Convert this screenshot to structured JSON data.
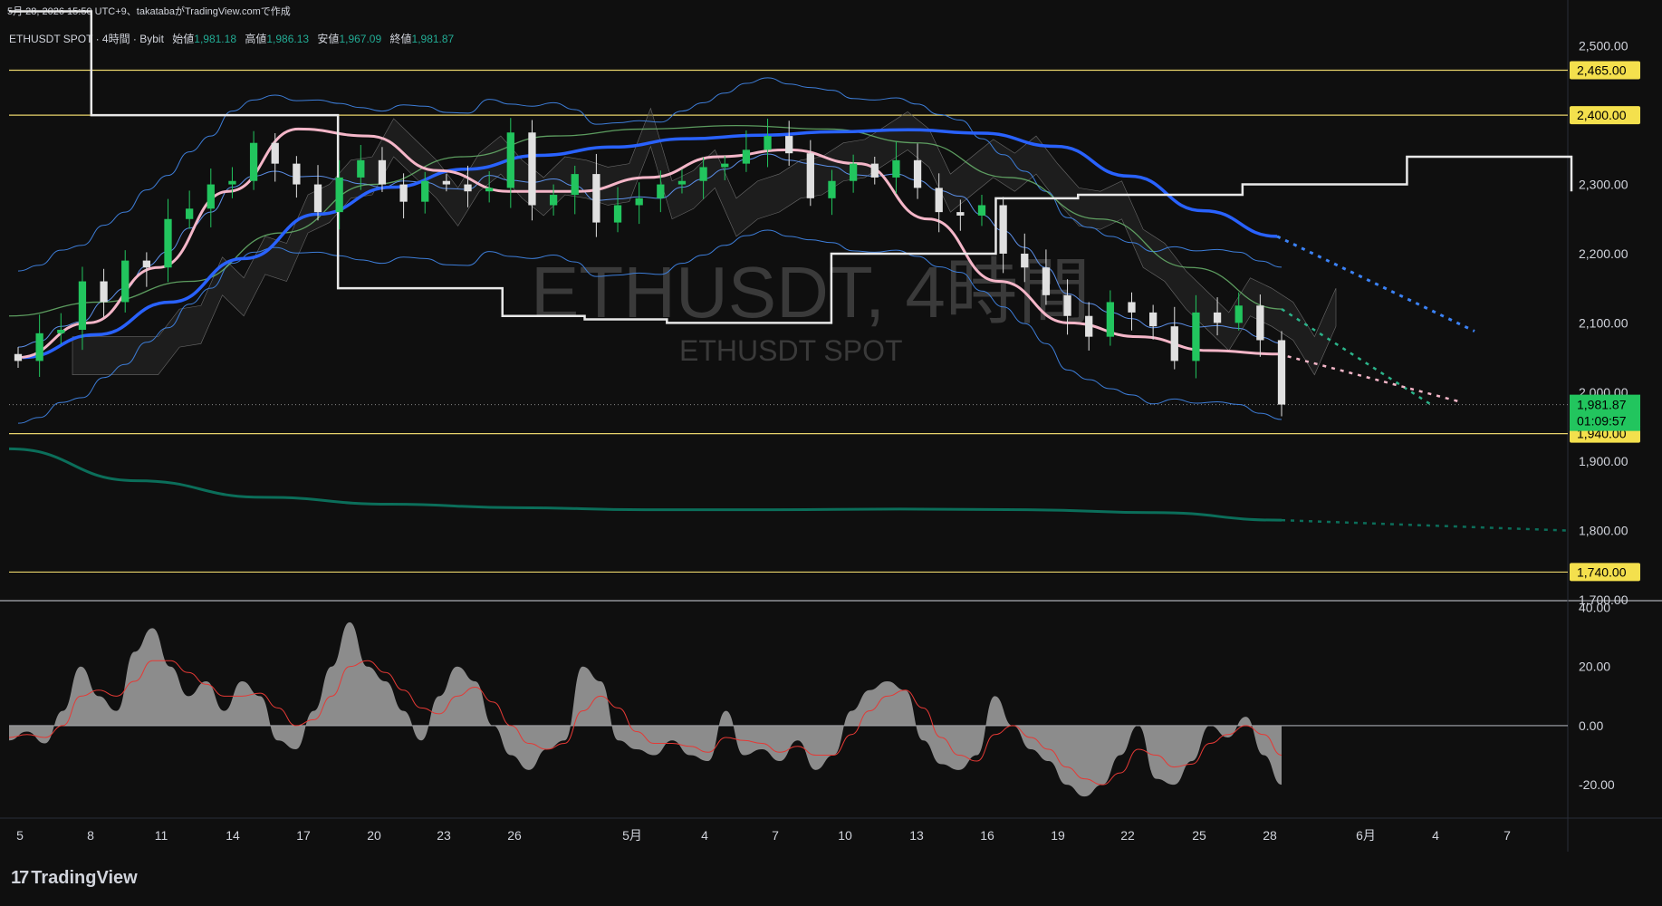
{
  "header": "5月 28, 2026 15:50 UTC+9、takatabaがTradingView.comで作成",
  "legend": {
    "symbol": "ETHUSDT SPOT · 4時間 · Bybit",
    "open_label": "始値",
    "open": "1,981.18",
    "high_label": "高値",
    "high": "1,986.13",
    "low_label": "安値",
    "low": "1,967.09",
    "close_label": "終値",
    "close": "1,981.87"
  },
  "watermark": {
    "title": "ETHUSDT, 4時間",
    "subtitle": "ETHUSDT SPOT"
  },
  "logo": {
    "text": "TradingView"
  },
  "colors": {
    "bg": "#0f0f0f",
    "up": "#22c55e",
    "down": "#e0e0e0",
    "ma_blue": "#2962ff",
    "ma_pink": "#f4b6c8",
    "ma_green": "#4caf50",
    "ma_teal": "#0b6e5a",
    "bb": "#3d7dd8",
    "level": "#e8d36b",
    "last_price": "#22c55e"
  },
  "chart_data": [
    {
      "type": "candlestick",
      "title": "",
      "yaxis_ticks": [
        "2,500.00",
        "2,400.00",
        "2,300.00",
        "2,200.00",
        "2,100.00",
        "2,000.00",
        "1,900.00",
        "1,800.00",
        "1,700.00"
      ],
      "ylim": [
        1700,
        2535
      ],
      "xaxis_ticks": [
        "5",
        "8",
        "11",
        "14",
        "17",
        "20",
        "23",
        "26",
        "5月",
        "4",
        "7",
        "10",
        "13",
        "16",
        "19",
        "22",
        "25",
        "28",
        "6月",
        "4",
        "7"
      ],
      "horizontal_levels": [
        "2,465.00",
        "2,400.00",
        "1,940.00",
        "1,740.00"
      ],
      "last_price": {
        "value": "1,981.87",
        "countdown": "01:09:57"
      },
      "series": [
        {
          "kind": "price_path",
          "values": [
            2045,
            2085,
            2090,
            2160,
            2130,
            2190,
            2180,
            2250,
            2265,
            2300,
            2305,
            2360,
            2330,
            2300,
            2260,
            2310,
            2335,
            2300,
            2275,
            2305,
            2300,
            2290,
            2295,
            2375,
            2270,
            2285,
            2315,
            2245,
            2270,
            2280,
            2300,
            2305,
            2325,
            2330,
            2350,
            2370,
            2345,
            2280,
            2305,
            2330,
            2310,
            2335,
            2295,
            2260,
            2255,
            2270,
            2200,
            2180,
            2140,
            2110,
            2080,
            2130,
            2115,
            2095,
            2045,
            2115,
            2100,
            2125,
            2075,
            1982
          ]
        },
        {
          "kind": "ma_slow_blue",
          "values": [
            2050,
            2083,
            2130,
            2193,
            2257,
            2296,
            2322,
            2342,
            2354,
            2366,
            2371,
            2376,
            2379,
            2374,
            2355,
            2312,
            2262,
            2225
          ]
        },
        {
          "kind": "ma_long_teal",
          "values": [
            1918,
            1872,
            1848,
            1838,
            1833,
            1830,
            1830,
            1831,
            1830,
            1826,
            1815
          ]
        },
        {
          "kind": "ma_mid_pink",
          "values": [
            2050,
            2100,
            2180,
            2290,
            2380,
            2370,
            2320,
            2290,
            2290,
            2310,
            2340,
            2350,
            2330,
            2250,
            2160,
            2100,
            2080,
            2060,
            2055
          ]
        },
        {
          "kind": "ma_green",
          "values": [
            2110,
            2130,
            2160,
            2230,
            2300,
            2340,
            2370,
            2380,
            2385,
            2380,
            2360,
            2310,
            2250,
            2180,
            2120
          ]
        },
        {
          "kind": "ichimoku_base_white",
          "values": [
            2550,
            2400,
            2400,
            2400,
            2150,
            2150,
            2110,
            2105,
            2100,
            2100,
            2200,
            2200,
            2280,
            2285,
            2285,
            2300,
            2300,
            2340,
            2340,
            2290
          ]
        }
      ]
    },
    {
      "type": "area",
      "title": "",
      "yaxis_ticks": [
        "40.00",
        "20.00",
        "0.00",
        "-20.00"
      ],
      "ylim": [
        -31,
        42
      ],
      "values": [
        -5,
        -2,
        -6,
        5,
        20,
        10,
        5,
        25,
        33,
        20,
        10,
        15,
        5,
        15,
        10,
        -5,
        -8,
        5,
        20,
        35,
        20,
        15,
        5,
        -5,
        10,
        20,
        15,
        0,
        -10,
        -15,
        -8,
        -5,
        20,
        15,
        -5,
        -8,
        -10,
        -5,
        -10,
        -12,
        5,
        -10,
        -8,
        -12,
        -5,
        -15,
        -10,
        5,
        12,
        15,
        12,
        -5,
        -13,
        -15,
        -10,
        10,
        0,
        -8,
        -12,
        -20,
        -24,
        -20,
        -10,
        0,
        -18,
        -20,
        -12,
        0,
        -4,
        3,
        -10,
        -20
      ],
      "signal": [
        -4,
        -3,
        -4,
        0,
        10,
        12,
        10,
        15,
        22,
        22,
        18,
        14,
        10,
        10,
        11,
        6,
        0,
        2,
        10,
        20,
        22,
        18,
        12,
        6,
        4,
        10,
        13,
        8,
        0,
        -6,
        -8,
        -6,
        5,
        10,
        6,
        -2,
        -6,
        -6,
        -7,
        -9,
        -4,
        -5,
        -6,
        -9,
        -7,
        -10,
        -10,
        -3,
        5,
        10,
        12,
        6,
        -4,
        -10,
        -12,
        -3,
        0,
        -4,
        -8,
        -14,
        -18,
        -20,
        -16,
        -8,
        -10,
        -14,
        -13,
        -6,
        -3,
        0,
        -3,
        -10
      ]
    }
  ]
}
